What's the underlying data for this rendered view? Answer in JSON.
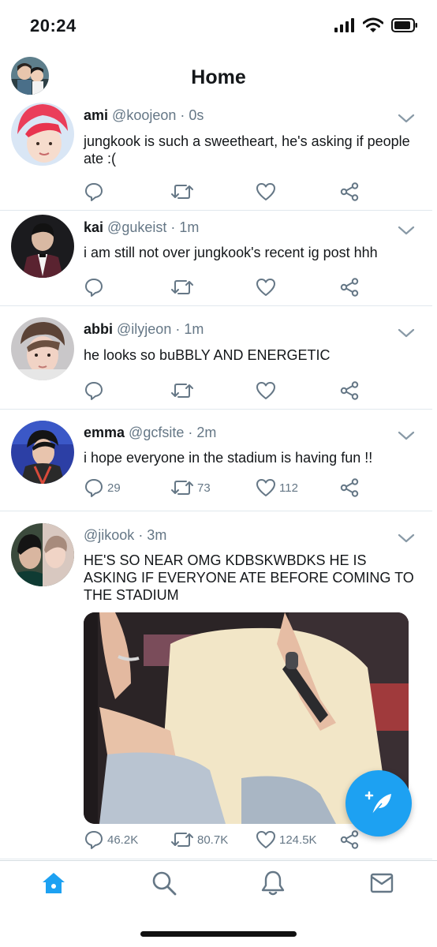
{
  "status_bar": {
    "time": "20:24",
    "icons": [
      "signal-icon",
      "wifi-icon",
      "battery-icon"
    ]
  },
  "header": {
    "title": "Home"
  },
  "colors": {
    "accent": "#1da1f2",
    "secondary_text": "#657786",
    "divider": "#e1e8ed"
  },
  "tweets": [
    {
      "name": "ami",
      "handle": "@koojeon",
      "time": "· 0s",
      "text": "jungkook is such a sweetheart, he's asking if people ate :(",
      "replies": "",
      "retweets": "",
      "likes": ""
    },
    {
      "name": "kai",
      "handle": "@gukeist",
      "time": "· 1m",
      "text": "i am still not over jungkook's recent ig post hhh",
      "replies": "",
      "retweets": "",
      "likes": ""
    },
    {
      "name": "abbi",
      "handle": "@ilyjeon",
      "time": "· 1m",
      "text": "he looks so buBBLY AND ENERGETIC",
      "replies": "",
      "retweets": "",
      "likes": ""
    },
    {
      "name": "emma",
      "handle": "@gcfsite",
      "time": "· 2m",
      "text": "i hope everyone in the stadium is having fun !!",
      "replies": "29",
      "retweets": "73",
      "likes": "112"
    },
    {
      "name": "",
      "handle": "@jikook",
      "time": "· 3m",
      "text": "HE'S SO NEAR OMG KDBSKWBDKS HE IS ASKING IF EVERYONE ATE BEFORE COMING TO THE STADIUM",
      "replies": "46.2K",
      "retweets": "80.7K",
      "likes": "124.5K"
    }
  ],
  "bottom_nav": [
    "home-icon",
    "search-icon",
    "notifications-icon",
    "messages-icon"
  ]
}
